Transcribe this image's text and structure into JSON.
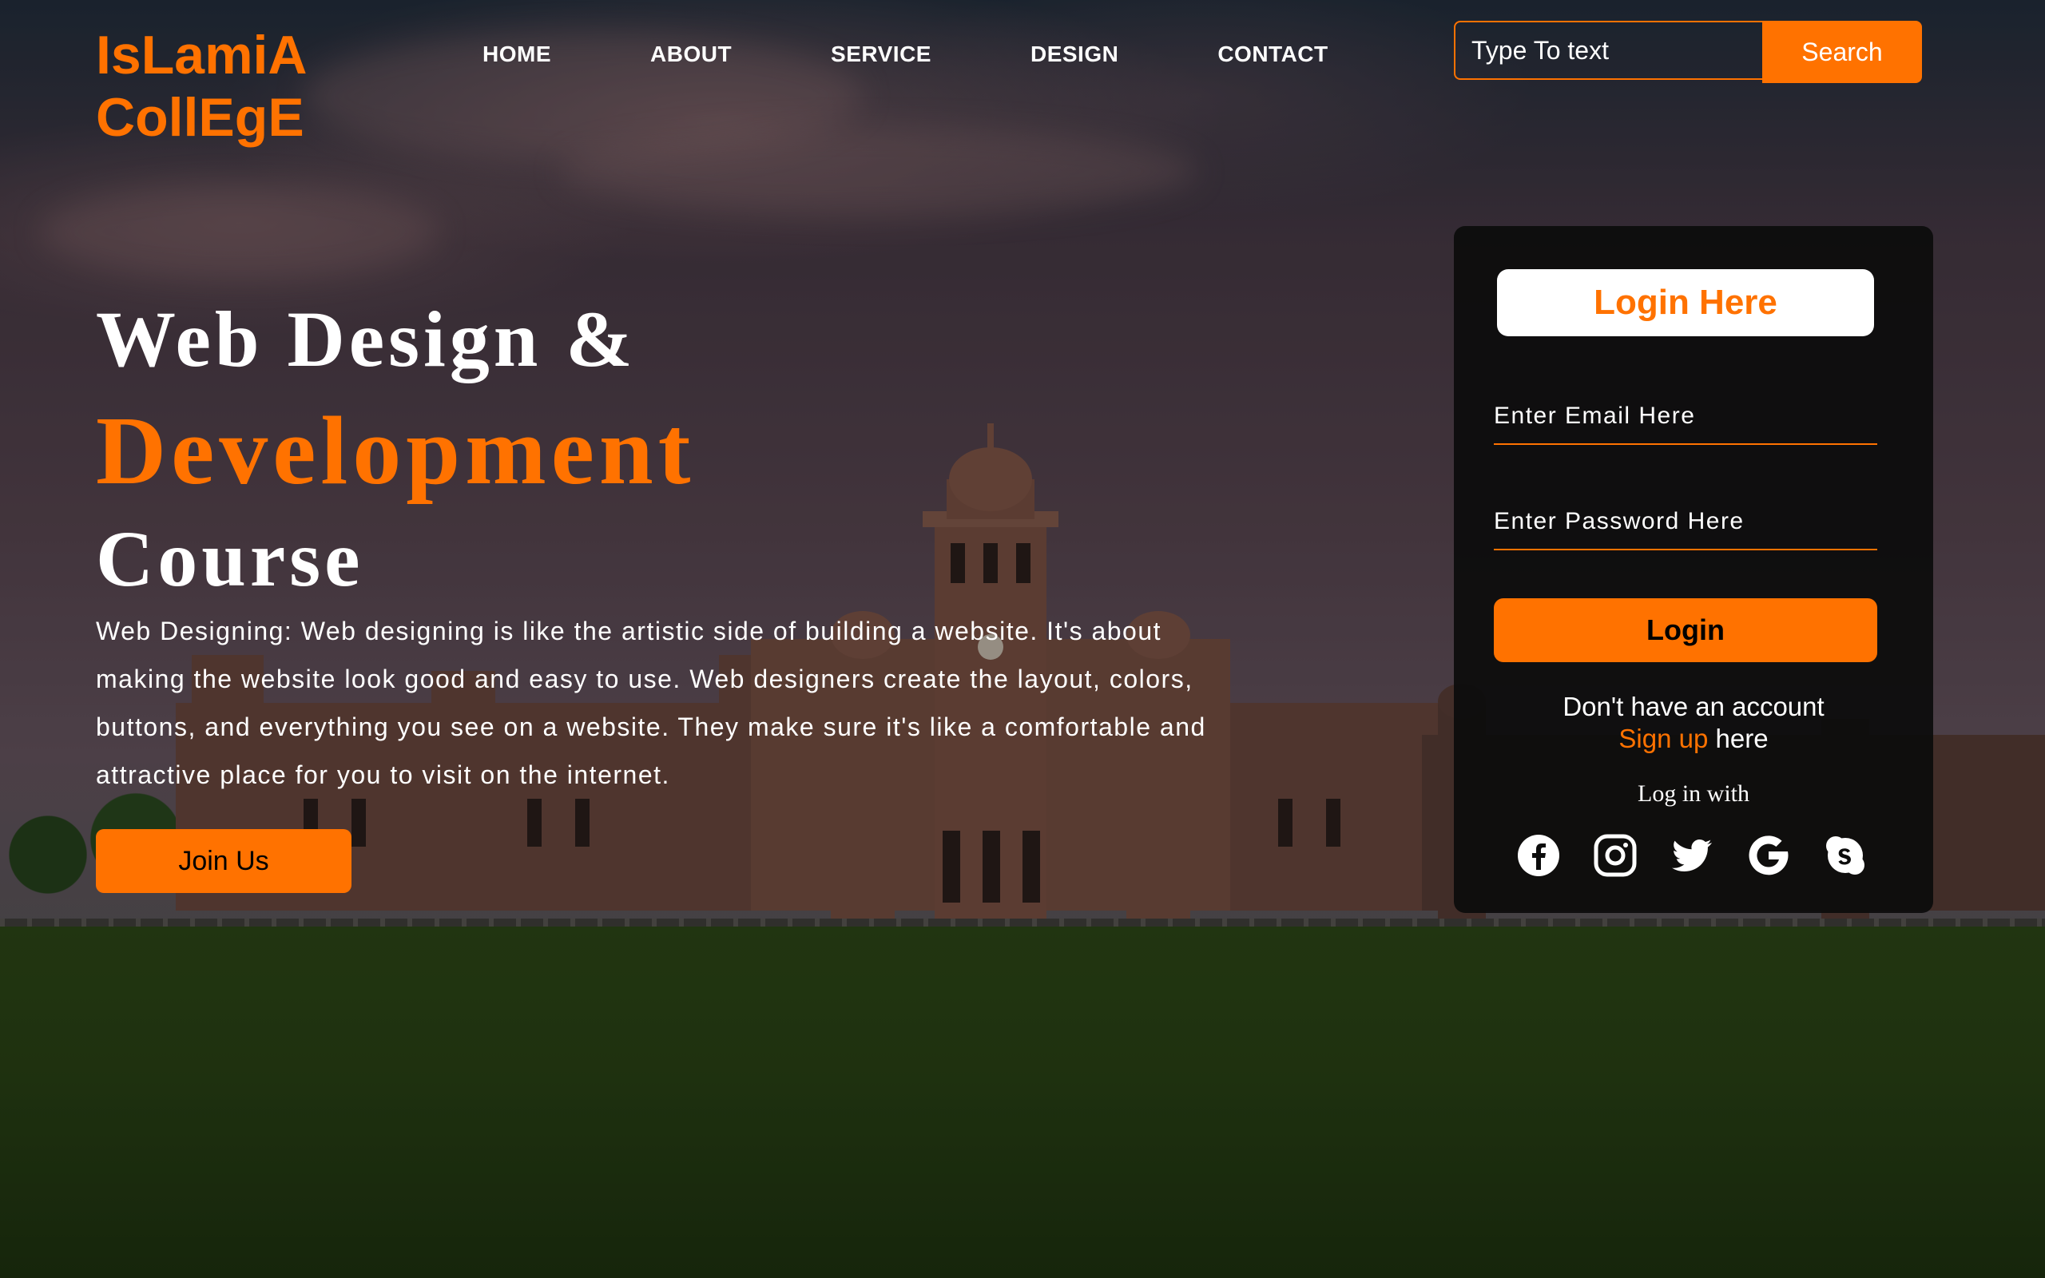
{
  "brand": {
    "line1": "IsLamiA",
    "line2": "CollEgE"
  },
  "nav": {
    "items": [
      "HOME",
      "ABOUT",
      "SERVICE",
      "DESIGN",
      "CONTACT"
    ]
  },
  "search": {
    "placeholder": "Type To text",
    "button_label": "Search"
  },
  "hero": {
    "title_line1": "Web Design &",
    "title_line2": "Development",
    "title_line3": "Course",
    "description": "Web Designing: Web designing is like the artistic side of building a website. It's about making the website look good and easy to use. Web designers create the layout, colors, buttons, and everything you see on a website. They make sure it's like a comfortable and attractive place for you to visit on the internet.",
    "cta_label": "Join Us"
  },
  "login": {
    "title": "Login Here",
    "email_placeholder": "Enter Email Here",
    "password_placeholder": "Enter Password Here",
    "button_label": "Login",
    "no_account_text": "Don't have an account",
    "signup_link": "Sign up",
    "signup_suffix": " here",
    "login_with": "Log in with",
    "socials": [
      "facebook-icon",
      "instagram-icon",
      "twitter-icon",
      "google-icon",
      "skype-icon"
    ]
  },
  "colors": {
    "accent": "#ff7200",
    "card_bg": "#0c0c0c",
    "text": "#ffffff"
  }
}
